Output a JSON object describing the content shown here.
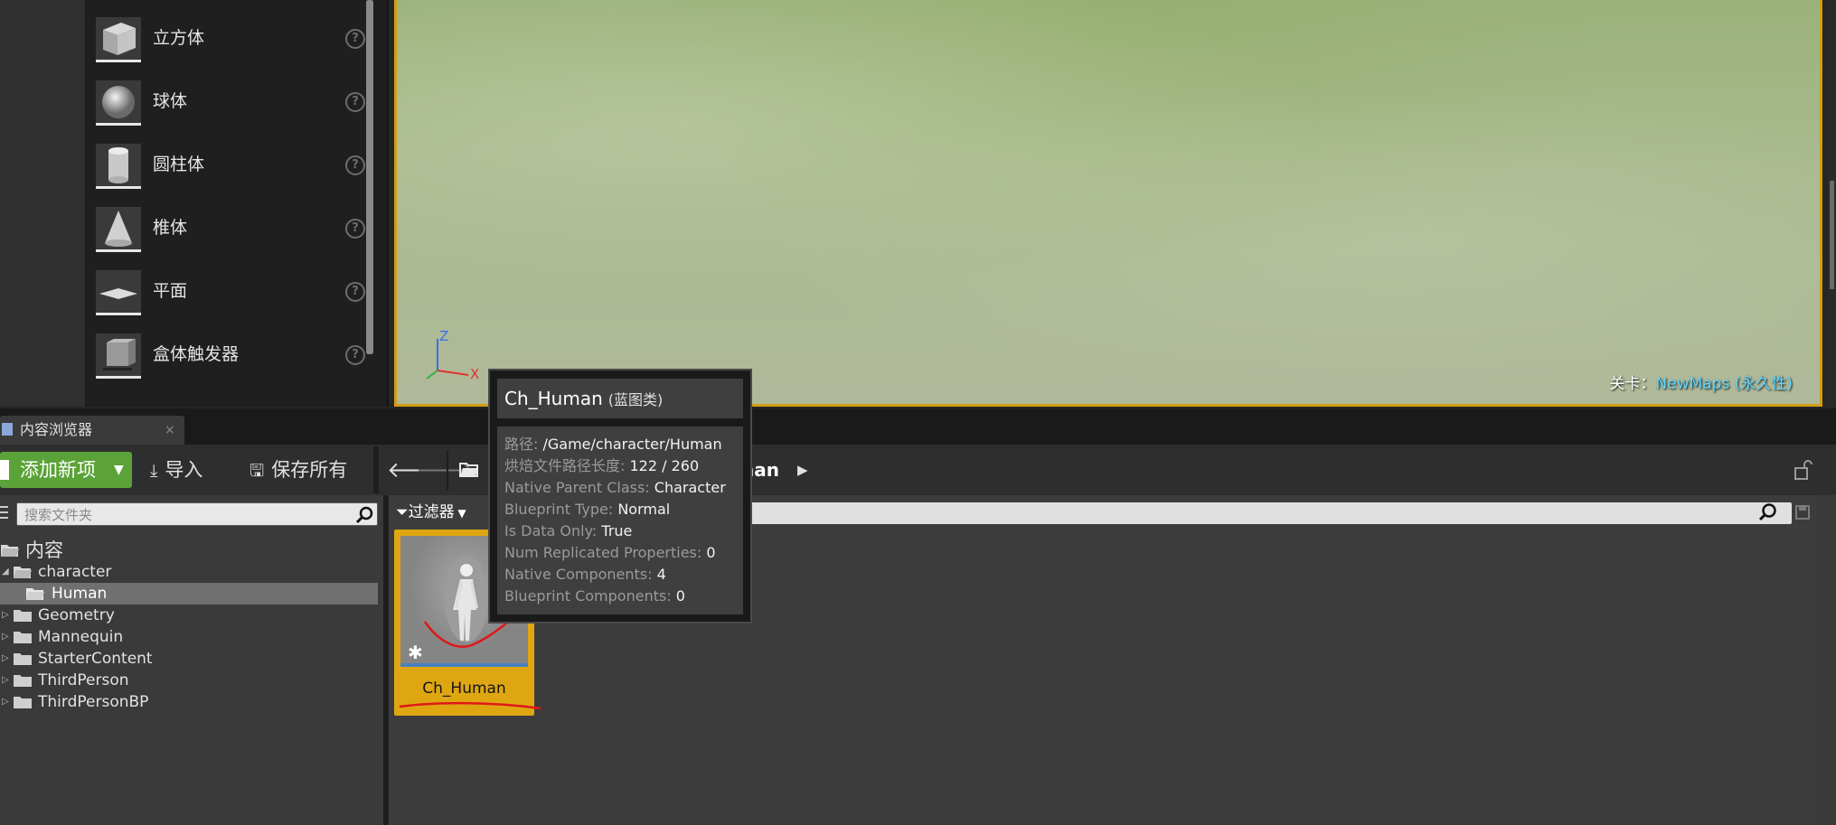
{
  "place_actors": {
    "items": [
      {
        "label": "立方体",
        "icon": "cube-icon"
      },
      {
        "label": "球体",
        "icon": "sphere-icon"
      },
      {
        "label": "圆柱体",
        "icon": "cylinder-icon"
      },
      {
        "label": "椎体",
        "icon": "cone-icon"
      },
      {
        "label": "平面",
        "icon": "plane-icon"
      },
      {
        "label": "盒体触发器",
        "icon": "box-trigger-icon"
      }
    ],
    "help_glyph": "?"
  },
  "viewport": {
    "axis_z": "Z",
    "axis_x": "X",
    "level_prefix": "关卡：",
    "level_name": "NewMaps (永久性)"
  },
  "content_browser": {
    "tab_label": "内容浏览器",
    "tab_close": "×",
    "add_new_label": "添加新项",
    "import_label": "导入",
    "save_all_label": "保存所有",
    "breadcrumb_current": "nan",
    "search_folders_placeholder": "搜索文件夹",
    "filter_label": "过滤器",
    "tree": [
      {
        "label": "内容",
        "depth": 0,
        "expanded": true
      },
      {
        "label": "character",
        "depth": 1,
        "expanded": true
      },
      {
        "label": "Human",
        "depth": 2,
        "selected": true
      },
      {
        "label": "Geometry",
        "depth": 1
      },
      {
        "label": "Mannequin",
        "depth": 1
      },
      {
        "label": "StarterContent",
        "depth": 1
      },
      {
        "label": "ThirdPerson",
        "depth": 1
      },
      {
        "label": "ThirdPersonBP",
        "depth": 1
      }
    ],
    "asset": {
      "name": "Ch_Human"
    }
  },
  "tooltip": {
    "title": "Ch_Human",
    "type": "(蓝图类)",
    "rows": [
      {
        "key": "路径:",
        "value": "/Game/character/Human"
      },
      {
        "key": "烘焙文件路径长度:",
        "value": "122 / 260"
      },
      {
        "key": "Native Parent Class:",
        "value": "Character"
      },
      {
        "key": "Blueprint Type:",
        "value": "Normal"
      },
      {
        "key": "Is Data Only:",
        "value": "True"
      },
      {
        "key": "Num Replicated Properties:",
        "value": "0"
      },
      {
        "key": "Native Components:",
        "value": "4"
      },
      {
        "key": "Blueprint Components:",
        "value": "0"
      }
    ]
  },
  "colors": {
    "accent_orange": "#dea712",
    "add_green": "#5ba338",
    "level_cyan": "#5fd7ff",
    "annotation_red": "#e01818"
  }
}
